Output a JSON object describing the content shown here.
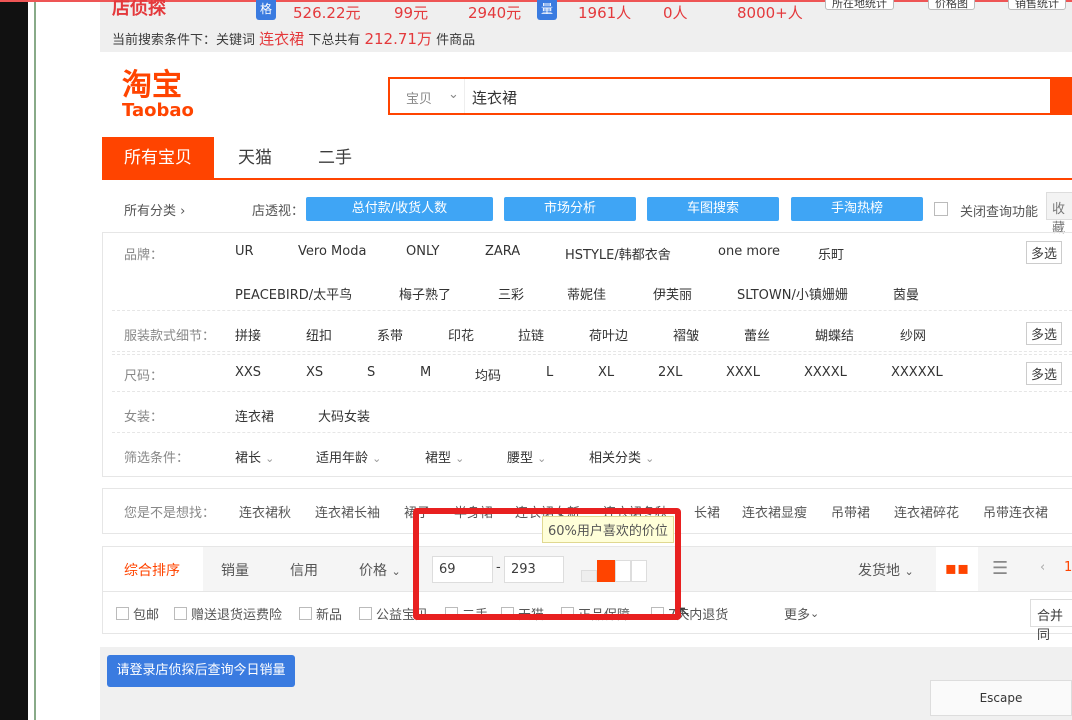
{
  "topbar": {
    "tag1": "格",
    "prices": [
      "526.22元",
      "99元",
      "2940元"
    ],
    "tag2": "量",
    "counts": [
      "1961人",
      "0人",
      "8000+人"
    ],
    "buttons": [
      "所在地统计",
      "价格图",
      "销售统计"
    ],
    "condition_prefix": "当前搜索条件下：关键词",
    "keyword": "连衣裙",
    "condition_mid": "下总共有",
    "total": "212.71万",
    "condition_suffix": "件商品"
  },
  "logo": {
    "cn": "淘宝",
    "en": "Taobao"
  },
  "search": {
    "scope": "宝贝",
    "value": "连衣裙"
  },
  "tabs": [
    "所有宝贝",
    "天猫",
    "二手"
  ],
  "toolbar": {
    "all_cat": "所有分类 ›",
    "shop_view": "店透视：",
    "buttons": [
      "总付款/收货人数",
      "市场分析",
      "车图搜索",
      "手淘热榜"
    ],
    "close_query": "关闭查询功能",
    "collect": "收藏"
  },
  "filters": {
    "brand_label": "品牌：",
    "brands_row1": [
      "UR",
      "Vero Moda",
      "ONLY",
      "ZARA",
      "HSTYLE/韩都衣舍",
      "one more",
      "乐町"
    ],
    "brands_row2": [
      "PEACEBIRD/太平鸟",
      "梅子熟了",
      "三彩",
      "蒂妮佳",
      "伊芙丽",
      "SLTOWN/小镇姗姗",
      "茵曼"
    ],
    "style_label": "服装款式细节：",
    "styles": [
      "拼接",
      "纽扣",
      "系带",
      "印花",
      "拉链",
      "荷叶边",
      "褶皱",
      "蕾丝",
      "蝴蝶结",
      "纱网"
    ],
    "size_label": "尺码：",
    "sizes": [
      "XXS",
      "XS",
      "S",
      "M",
      "均码",
      "L",
      "XL",
      "2XL",
      "XXXL",
      "XXXXL",
      "XXXXXL"
    ],
    "women_label": "女装：",
    "women": [
      "连衣裙",
      "大码女装"
    ],
    "cond_label": "筛选条件：",
    "conds": [
      "裙长",
      "适用年龄",
      "裙型",
      "腰型",
      "相关分类"
    ],
    "multi": "多选"
  },
  "suggest": {
    "label": "您是不是想找：",
    "items": [
      "连衣裙秋",
      "连衣裙长袖",
      "裙子",
      "半身裙",
      "连衣裙女新",
      "连衣裙冬秋",
      "长裙",
      "连衣裙显瘦",
      "吊带裙",
      "连衣裙碎花",
      "吊带连衣裙"
    ]
  },
  "sort": {
    "items": [
      "综合排序",
      "销量",
      "信用",
      "价格"
    ],
    "price_min": "69",
    "price_max": "293",
    "dash": "-",
    "ship": "发货地",
    "tooltip": "60%用户喜欢的价位",
    "page": "1"
  },
  "checks": [
    "包邮",
    "赠送退货运费险",
    "新品",
    "公益宝贝",
    "二手",
    "天猫",
    "正品保障",
    "7天内退货"
  ],
  "more": "更多",
  "merge": "合并同",
  "login_btn": "请登录店侦探后查询今日销量",
  "escape": "Escape",
  "colors": {
    "accent": "#ff4400",
    "blue": "#3fa5f5",
    "highlight": "#e82020"
  }
}
